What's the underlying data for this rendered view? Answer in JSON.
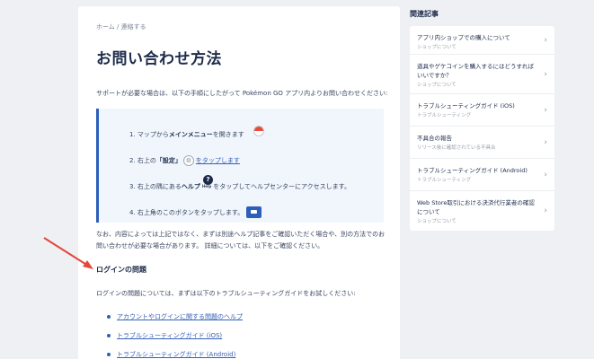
{
  "breadcrumb": {
    "home": "ホーム",
    "separator": " / ",
    "current": "連絡する"
  },
  "article": {
    "title": "お問い合わせ方法",
    "intro": "サポートが必要な場合は、以下の手順にしたがって Pokémon GO アプリ内よりお問い合わせください:",
    "steps": {
      "s1_a": "1. マップから",
      "s1_b": "メインメニュー",
      "s1_c": "を開きます",
      "s2_a": "2. 右上の",
      "s2_b": "「設定」",
      "s2_c": "をタップします",
      "s3_a": "3. 右上の隅にある",
      "s3_b": "ヘルプ",
      "s3_c": "をタップしてヘルプセンターにアクセスします。",
      "s4": "4. 右上角のこのボタンをタップします。"
    },
    "help_icon_label": "?",
    "help_icon_sub": "Help",
    "note": "なお、内容によっては上記ではなく、まずは別途ヘルプ記事をご確認いただく場合や、別の方法でのお問い合わせが必要な場合があります。 詳細については、以下をご確認ください。",
    "section_heading": "ログインの問題",
    "section_text": "ログインの問題については、まずは以下のトラブルシューティングガイドをお試しください:",
    "links": [
      "アカウントやログインに関する問題のヘルプ",
      "トラブルシューティングガイド (iOS)",
      "トラブルシューティングガイド (Android)"
    ]
  },
  "sidebar": {
    "title": "関連記事",
    "items": [
      {
        "title": "アプリ内ショップでの購入について",
        "sub": "ショップについて"
      },
      {
        "title": "道具やゲケコインを購入するにはどうすればいいですか？",
        "sub": "ショップについて"
      },
      {
        "title": "トラブルシューティングガイド (iOS)",
        "sub": "トラブルシューティング"
      },
      {
        "title": "不具合の報告",
        "sub": "リリース後に確認されている不具合"
      },
      {
        "title": "トラブルシューティングガイド (Android)",
        "sub": "トラブルシューティング"
      },
      {
        "title": "Web Store取引における決済代行業者の確認について",
        "sub": "ショップについて"
      }
    ]
  },
  "colors": {
    "accent": "#2d5fb8",
    "link": "#3561b6",
    "arrow": "#e4473b",
    "background": "#eef0f3"
  }
}
